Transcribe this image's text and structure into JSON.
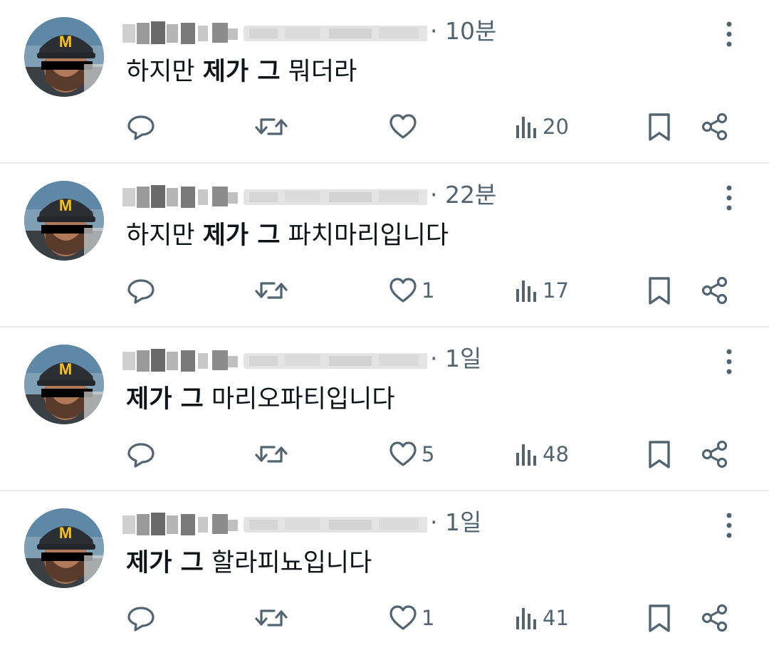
{
  "tweets": [
    {
      "time": "· 10분",
      "text_bold": "",
      "text_prefix": "하지만 ",
      "text_bold_mid": "제가 그",
      "text_rest": " 뭐더라",
      "likes": "",
      "views": "20"
    },
    {
      "time": "· 22분",
      "text_bold": "",
      "text_prefix": "하지만 ",
      "text_bold_mid": "제가 그",
      "text_rest": " 파치마리입니다",
      "likes": "1",
      "views": "17"
    },
    {
      "time": "· 1일",
      "text_bold": "",
      "text_prefix": "",
      "text_bold_mid": "제가 그",
      "text_rest": " 마리오파티입니다",
      "likes": "5",
      "views": "48"
    },
    {
      "time": "· 1일",
      "text_bold": "",
      "text_prefix": "",
      "text_bold_mid": "제가 그",
      "text_rest": " 할라피뇨입니다",
      "likes": "1",
      "views": "41"
    }
  ],
  "icons": {
    "reply": "reply-icon",
    "retweet": "retweet-icon",
    "like": "heart-icon",
    "views": "views-icon",
    "bookmark": "bookmark-icon",
    "share": "share-icon",
    "more": "more-icon"
  },
  "colors": {
    "text": "#0f1419",
    "secondary": "#536471",
    "divider": "#e7e9ea",
    "cap_logo": "#f6c21b"
  }
}
